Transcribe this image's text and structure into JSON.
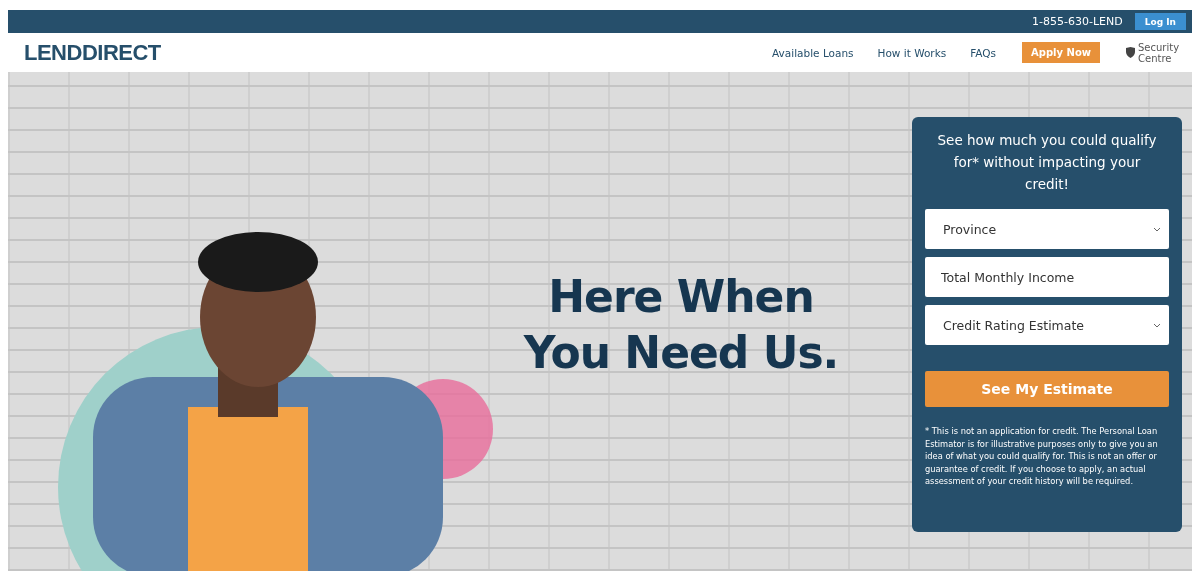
{
  "top_bar": {
    "phone": "1-855-630-LEND",
    "login_button": "Log In"
  },
  "nav": {
    "logo": "LENDDIRECT",
    "links": [
      {
        "label": "Available Loans"
      },
      {
        "label": "How it Works"
      },
      {
        "label": "FAQs"
      }
    ],
    "apply_button": "Apply Now",
    "security_link": "Security Centre"
  },
  "hero": {
    "headline": "Here When You Need Us."
  },
  "estimate_form": {
    "title": "See how much you could qualify for* without impacting your credit!",
    "fields": [
      {
        "kind": "select",
        "placeholder": "Province"
      },
      {
        "kind": "input",
        "placeholder": "Total Monthly Income"
      },
      {
        "kind": "select",
        "placeholder": "Credit Rating Estimate"
      }
    ],
    "submit_button": "See My Estimate",
    "disclaimer": "* This is not an application for credit. The Personal Loan Estimator is for illustrative purposes only to give you an idea of what you could qualify for. This is not an offer or guarantee of credit. If you choose to apply, an actual assessment of your credit history will be required."
  }
}
